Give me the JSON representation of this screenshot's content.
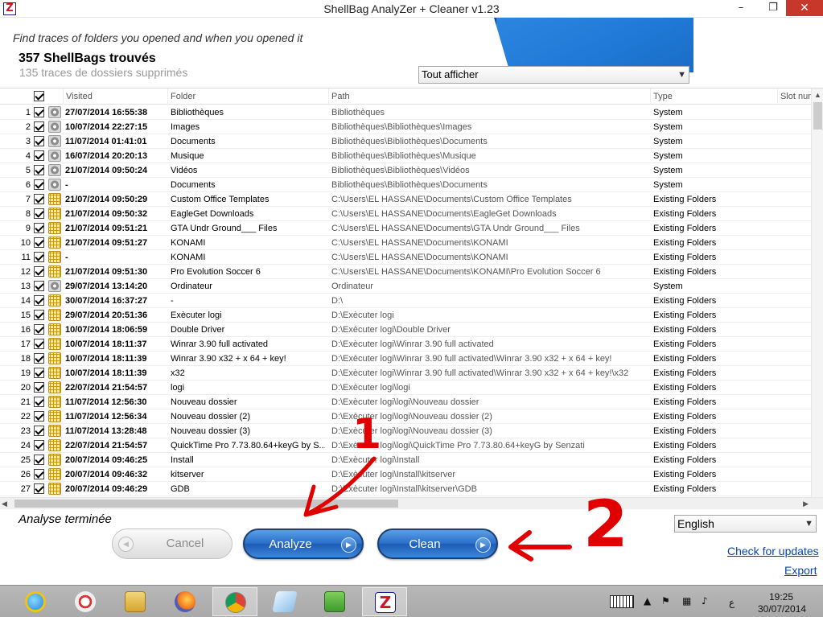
{
  "window": {
    "title": "ShellBag  AnalyZer + Cleaner v1.23",
    "app_icon": "shellbag-logo-icon",
    "minimize": "–",
    "maximize": "❐",
    "close": "✕"
  },
  "header": {
    "tagline": "Find traces of folders you opened and when you opened it",
    "found_count": "357 ShellBags trouvés",
    "deleted_count": "135 traces de dossiers supprimés",
    "filter_value": "Tout afficher"
  },
  "grid": {
    "columns": [
      "Visited",
      "Folder",
      "Path",
      "Type",
      "Slot num"
    ],
    "rows": [
      {
        "n": "1",
        "icon": "system-gear-icon",
        "visited": "27/07/2014 16:55:38",
        "folder": "Bibliothèques",
        "path": "Bibliothèques",
        "type": "System"
      },
      {
        "n": "2",
        "icon": "system-gear-icon",
        "visited": "10/07/2014 22:27:15",
        "folder": "Images",
        "path": "Bibliothèques\\Bibliothèques\\Images",
        "type": "System"
      },
      {
        "n": "3",
        "icon": "system-gear-icon",
        "visited": "11/07/2014 01:41:01",
        "folder": "Documents",
        "path": "Bibliothèques\\Bibliothèques\\Documents",
        "type": "System"
      },
      {
        "n": "4",
        "icon": "system-gear-icon",
        "visited": "16/07/2014 20:20:13",
        "folder": "Musique",
        "path": "Bibliothèques\\Bibliothèques\\Musique",
        "type": "System"
      },
      {
        "n": "5",
        "icon": "system-gear-icon",
        "visited": "21/07/2014 09:50:24",
        "folder": "Vidéos",
        "path": "Bibliothèques\\Bibliothèques\\Vidéos",
        "type": "System"
      },
      {
        "n": "6",
        "icon": "system-gear-icon",
        "visited": "-",
        "folder": "Documents",
        "path": "Bibliothèques\\Bibliothèques\\Documents",
        "type": "System"
      },
      {
        "n": "7",
        "icon": "folder-grid-icon",
        "visited": "21/07/2014 09:50:29",
        "folder": "Custom Office Templates",
        "path": "C:\\Users\\EL HASSANE\\Documents\\Custom Office Templates",
        "type": "Existing Folders"
      },
      {
        "n": "8",
        "icon": "folder-grid-icon",
        "visited": "21/07/2014 09:50:32",
        "folder": "EagleGet Downloads",
        "path": "C:\\Users\\EL HASSANE\\Documents\\EagleGet Downloads",
        "type": "Existing Folders"
      },
      {
        "n": "9",
        "icon": "folder-grid-icon",
        "visited": "21/07/2014 09:51:21",
        "folder": "GTA Undr Ground___ Files",
        "path": "C:\\Users\\EL HASSANE\\Documents\\GTA Undr Ground___ Files",
        "type": "Existing Folders"
      },
      {
        "n": "10",
        "icon": "folder-grid-icon",
        "visited": "21/07/2014 09:51:27",
        "folder": "KONAMI",
        "path": "C:\\Users\\EL HASSANE\\Documents\\KONAMI",
        "type": "Existing Folders"
      },
      {
        "n": "11",
        "icon": "folder-grid-icon",
        "visited": "-",
        "folder": "KONAMI",
        "path": "C:\\Users\\EL HASSANE\\Documents\\KONAMI",
        "type": "Existing Folders"
      },
      {
        "n": "12",
        "icon": "folder-grid-icon",
        "visited": "21/07/2014 09:51:30",
        "folder": "Pro Evolution Soccer 6",
        "path": "C:\\Users\\EL HASSANE\\Documents\\KONAMI\\Pro Evolution Soccer 6",
        "type": "Existing Folders"
      },
      {
        "n": "13",
        "icon": "system-gear-icon",
        "visited": "29/07/2014 13:14:20",
        "folder": "Ordinateur",
        "path": "Ordinateur",
        "type": "System"
      },
      {
        "n": "14",
        "icon": "folder-grid-icon",
        "visited": "30/07/2014 16:37:27",
        "folder": "-",
        "path": "D:\\",
        "type": "Existing Folders"
      },
      {
        "n": "15",
        "icon": "folder-grid-icon",
        "visited": "29/07/2014 20:51:36",
        "folder": "Exècuter logi",
        "path": "D:\\Exècuter logi",
        "type": "Existing Folders"
      },
      {
        "n": "16",
        "icon": "folder-grid-icon",
        "visited": "10/07/2014 18:06:59",
        "folder": "Double Driver",
        "path": "D:\\Exècuter logi\\Double Driver",
        "type": "Existing Folders"
      },
      {
        "n": "17",
        "icon": "folder-grid-icon",
        "visited": "10/07/2014 18:11:37",
        "folder": "Winrar 3.90 full activated",
        "path": "D:\\Exècuter logi\\Winrar 3.90 full activated",
        "type": "Existing Folders"
      },
      {
        "n": "18",
        "icon": "folder-grid-icon",
        "visited": "10/07/2014 18:11:39",
        "folder": "Winrar 3.90 x32 + x 64 + key!",
        "path": "D:\\Exècuter logi\\Winrar 3.90 full activated\\Winrar 3.90 x32 + x 64 + key!",
        "type": "Existing Folders"
      },
      {
        "n": "19",
        "icon": "folder-grid-icon",
        "visited": "10/07/2014 18:11:39",
        "folder": "x32",
        "path": "D:\\Exècuter logi\\Winrar 3.90 full activated\\Winrar 3.90 x32 + x 64 + key!\\x32",
        "type": "Existing Folders"
      },
      {
        "n": "20",
        "icon": "folder-grid-icon",
        "visited": "22/07/2014 21:54:57",
        "folder": "logi",
        "path": "D:\\Exècuter logi\\logi",
        "type": "Existing Folders"
      },
      {
        "n": "21",
        "icon": "folder-grid-icon",
        "visited": "11/07/2014 12:56:30",
        "folder": "Nouveau dossier",
        "path": "D:\\Exècuter logi\\logi\\Nouveau dossier",
        "type": "Existing Folders"
      },
      {
        "n": "22",
        "icon": "folder-grid-icon",
        "visited": "11/07/2014 12:56:34",
        "folder": "Nouveau dossier (2)",
        "path": "D:\\Exècuter logi\\logi\\Nouveau dossier (2)",
        "type": "Existing Folders"
      },
      {
        "n": "23",
        "icon": "folder-grid-icon",
        "visited": "11/07/2014 13:28:48",
        "folder": "Nouveau dossier (3)",
        "path": "D:\\Exècuter logi\\logi\\Nouveau dossier (3)",
        "type": "Existing Folders"
      },
      {
        "n": "24",
        "icon": "folder-grid-icon",
        "visited": "22/07/2014 21:54:57",
        "folder": "QuickTime Pro  7.73.80.64+keyG by S...",
        "path": "D:\\Exècuter logi\\logi\\QuickTime Pro  7.73.80.64+keyG by Senzati",
        "type": "Existing Folders"
      },
      {
        "n": "25",
        "icon": "folder-grid-icon",
        "visited": "20/07/2014 09:46:25",
        "folder": "Install",
        "path": "D:\\Exècuter logi\\Install",
        "type": "Existing Folders"
      },
      {
        "n": "26",
        "icon": "folder-grid-icon",
        "visited": "20/07/2014 09:46:32",
        "folder": "kitserver",
        "path": "D:\\Exècuter logi\\Install\\kitserver",
        "type": "Existing Folders"
      },
      {
        "n": "27",
        "icon": "folder-grid-icon",
        "visited": "20/07/2014 09:46:29",
        "folder": "GDB",
        "path": "D:\\Exècuter logi\\Install\\kitserver\\GDB",
        "type": "Existing Folders"
      }
    ]
  },
  "scroll": {
    "up": "▲",
    "left": "◀",
    "right": "▶"
  },
  "footer": {
    "status": "Analyse terminée",
    "language": "English",
    "cancel_label": "Cancel",
    "analyze_label": "Analyze",
    "clean_label": "Clean",
    "btn_arrow": "▶",
    "btn_arrow_back": "◀",
    "check_updates": "Check for updates",
    "export": "Export"
  },
  "annotations": {
    "one": "1",
    "two": "2",
    "color": "#e00000"
  },
  "taskbar": {
    "apps": [
      "internet-explorer-icon",
      "paint-icon",
      "file-explorer-icon",
      "firefox-icon",
      "chrome-icon",
      "notes-icon",
      "cubes-app-icon",
      "shellbag-taskbar-icon"
    ],
    "shellbag_glyph": "Z",
    "tray_up": "▲",
    "tray_flag": "⚑",
    "tray_net": "▦",
    "tray_volume": "♪",
    "lang": "ع",
    "time": "19:25",
    "date": "30/07/2014"
  }
}
